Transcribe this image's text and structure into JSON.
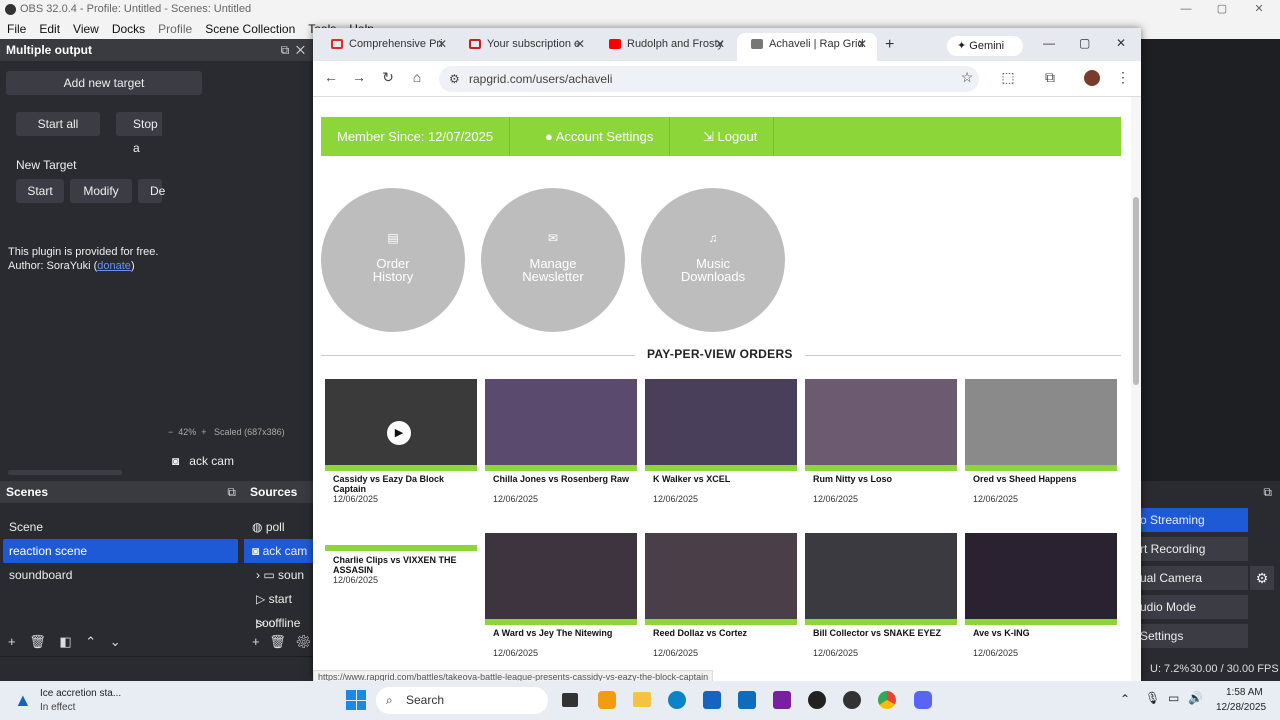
{
  "obs": {
    "title": "OBS 32.0.4 - Profile: Untitled - Scenes: Untitled",
    "menu": [
      "File",
      "Edit",
      "View",
      "Docks",
      "Profile",
      "Scene Collection",
      "Tools",
      "Help"
    ],
    "multi_output": {
      "title": "Multiple output",
      "add_target": "Add new target",
      "start_all": "Start all",
      "stop_all": "Stop a",
      "new_target": "New Target",
      "start": "Start",
      "modify": "Modify",
      "delete": "De",
      "plugin_text": "This plugin is provided for free.",
      "author_prefix": "Author: SoraYuki (",
      "donate": "donate",
      "author_suffix": ")"
    },
    "zoom": "42%",
    "scaled": "Scaled (687x386)",
    "source_label": "ack cam",
    "scenes": {
      "title": "Scenes",
      "items": [
        "Scene",
        "reaction scene",
        "soundboard"
      ],
      "selected": 1
    },
    "sources": {
      "title": "Sources",
      "items": [
        "poll",
        "ack cam",
        "soun",
        "start soo",
        "offline"
      ]
    },
    "controls": [
      "o Streaming",
      "rt Recording",
      "ual Camera",
      "udio Mode",
      "Settings"
    ],
    "status": {
      "cpu": "U: 7.2%",
      "fps": "30.00 / 30.00 FPS"
    }
  },
  "chrome": {
    "tabs": [
      {
        "title": "Comprehensive Pri",
        "color": "#d93025"
      },
      {
        "title": "Your subscription e",
        "color": "#c5221f"
      },
      {
        "title": "Rudolph and Frosty",
        "color": "#ff0000"
      },
      {
        "title": "Achaveli | Rap Grid",
        "color": "#555555"
      }
    ],
    "gemini": "Gemini",
    "url": "rapgrid.com/users/achaveli"
  },
  "site": {
    "member_since": "Member Since: 12/07/2025",
    "account_settings": "Account Settings",
    "logout": "Logout",
    "circles": [
      {
        "line1": "Order",
        "line2": "History",
        "icon": "document-icon"
      },
      {
        "line1": "Manage",
        "line2": "Newsletter",
        "icon": "envelope-icon"
      },
      {
        "line1": "Music",
        "line2": "Downloads",
        "icon": "music-icon"
      }
    ],
    "ppv_title": "PAY-PER-VIEW ORDERS",
    "orders": [
      {
        "title": "Cassidy vs Eazy Da Block Captain",
        "date": "12/06/2025",
        "color": "#3a3a3a"
      },
      {
        "title": "Chilla Jones vs Rosenberg Raw",
        "date": "12/06/2025",
        "color": "#5a4a6e"
      },
      {
        "title": "K Walker vs XCEL",
        "date": "12/06/2025",
        "color": "#4a3f5a"
      },
      {
        "title": "Rum Nitty vs Loso",
        "date": "12/06/2025",
        "color": "#6b5a70"
      },
      {
        "title": "Ored vs Sheed Happens",
        "date": "12/06/2025",
        "color": "#8a8a8a"
      },
      {
        "title": "Charlie Clips vs VIXXEN THE ASSASIN",
        "date": "12/06/2025",
        "color": "#ffffff"
      },
      {
        "title": "A Ward vs Jey The Nitewing",
        "date": "12/06/2025",
        "color": "#3d3440"
      },
      {
        "title": "Reed Dollaz vs Cortez",
        "date": "12/06/2025",
        "color": "#4a3f48"
      },
      {
        "title": "Bill Collector vs SNAKE EYEZ",
        "date": "12/06/2025",
        "color": "#3b3a40"
      },
      {
        "title": "Ave vs K-ING",
        "date": "12/06/2025",
        "color": "#2a2230"
      }
    ],
    "status_link": "https://www.rapgrid.com/battles/takeova-battle-league-presents-cassidy-vs-eazy-the-block-captain"
  },
  "taskbar": {
    "weather_title": "Ice accretion sta...",
    "weather_sub": "In effect",
    "search": "Search",
    "time": "1:58 AM",
    "date": "12/28/2025"
  }
}
